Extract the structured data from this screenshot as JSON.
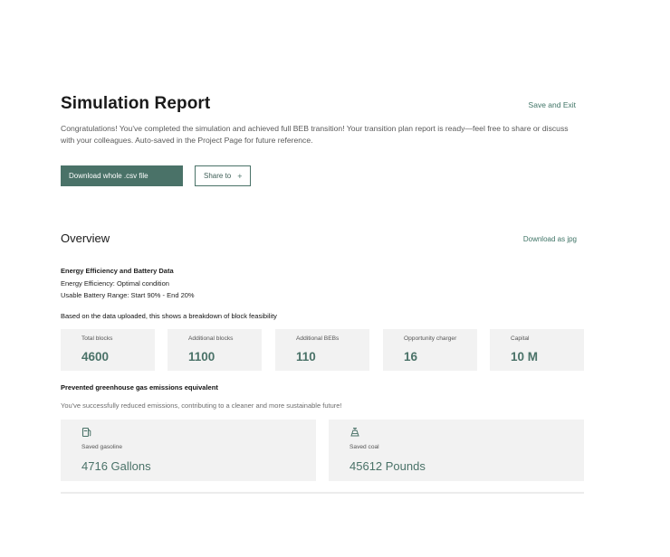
{
  "header": {
    "title": "Simulation Report",
    "save_exit": "Save and Exit"
  },
  "intro": {
    "text": "Congratulations! You've completed the simulation and achieved full BEB transition! Your transition plan report is ready—feel free to share or discuss with your colleagues. Auto-saved in the Project Page for future reference."
  },
  "actions": {
    "download_csv": "Download whole .csv file",
    "share_to": "Share to",
    "share_icon": "plus-icon"
  },
  "overview": {
    "title": "Overview",
    "download_jpg": "Download as jpg"
  },
  "energy": {
    "heading": "Energy Efficiency and Battery Data",
    "efficiency": "Energy Efficiency: Optimal condition",
    "battery_range": "Usable Battery Range: Start 90% - End 20%"
  },
  "breakdown": {
    "label": "Based on the data uploaded, this shows a breakdown of block feasibility",
    "stats": [
      {
        "label": "Total blocks",
        "value": "4600"
      },
      {
        "label": "Additional blocks",
        "value": "1100"
      },
      {
        "label": "Additional BEBs",
        "value": "110"
      },
      {
        "label": "Opportunity charger",
        "value": "16"
      },
      {
        "label": "Capital",
        "value": "10 M"
      }
    ]
  },
  "emissions": {
    "title": "Prevented greenhouse gas emissions equivalent",
    "subtitle": "You've successfully reduced emissions, contributing to a cleaner and more sustainable future!",
    "items": [
      {
        "icon": "gas-pump-icon",
        "label": "Saved gasoline",
        "value": "4716 Gallons"
      },
      {
        "icon": "coal-icon",
        "label": "Saved coal",
        "value": "45612 Pounds"
      }
    ]
  },
  "colors": {
    "accent": "#4a7268",
    "card_bg": "#f2f2f2",
    "link": "#3f7466"
  }
}
